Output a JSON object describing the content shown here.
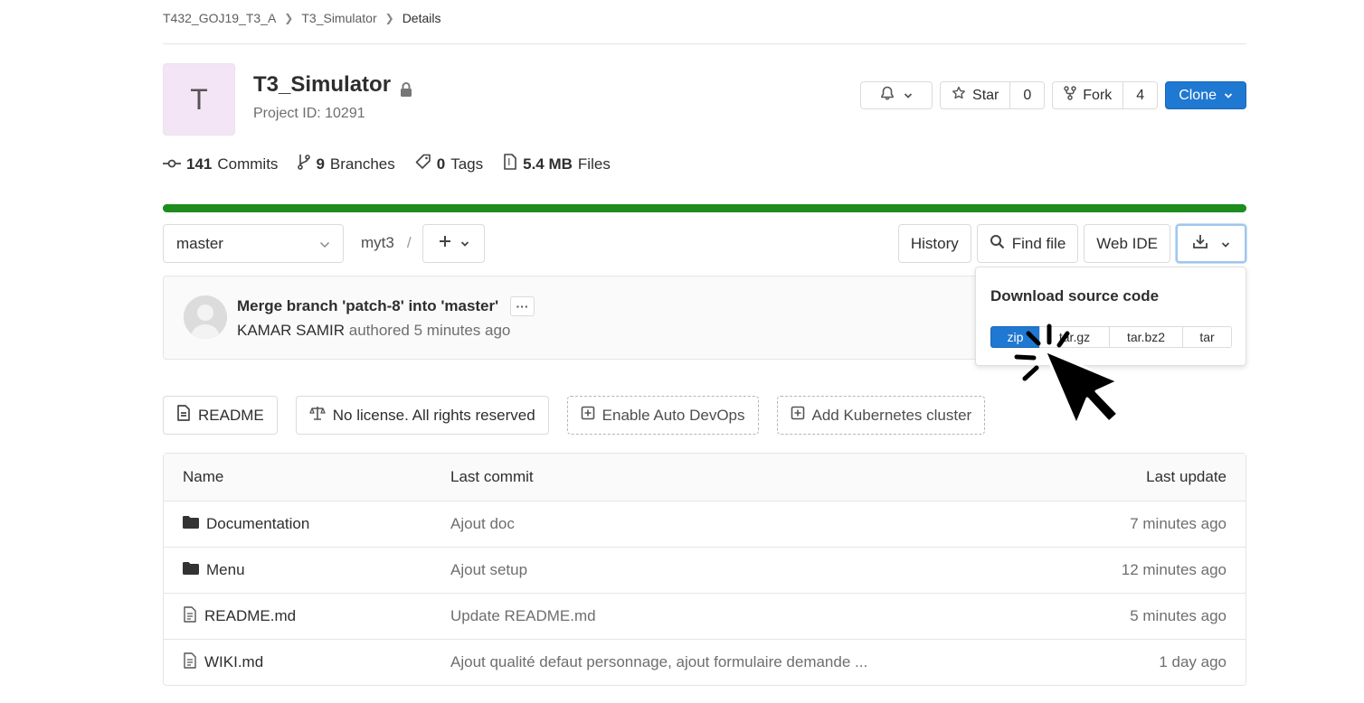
{
  "breadcrumb": [
    "T432_GOJ19_T3_A",
    "T3_Simulator",
    "Details"
  ],
  "project": {
    "avatar_letter": "T",
    "name": "T3_Simulator",
    "id_label": "Project ID: 10291"
  },
  "header_buttons": {
    "star_label": "Star",
    "star_count": "0",
    "fork_label": "Fork",
    "fork_count": "4",
    "clone_label": "Clone"
  },
  "stats": {
    "commits_count": "141",
    "commits_label": "Commits",
    "branches_count": "9",
    "branches_label": "Branches",
    "tags_count": "0",
    "tags_label": "Tags",
    "files_size": "5.4 MB",
    "files_label": "Files"
  },
  "language_bar": {
    "color": "#1f8c1f",
    "fraction": 1.0
  },
  "tree": {
    "branch": "master",
    "path": "myt3",
    "history_label": "History",
    "find_file_label": "Find file",
    "web_ide_label": "Web IDE"
  },
  "commit": {
    "message": "Merge branch 'patch-8' into 'master'",
    "author": "KAMAR SAMIR",
    "meta": "authored 5 minutes ago"
  },
  "download_dropdown": {
    "title": "Download source code",
    "formats": [
      "zip",
      "tar.gz",
      "tar.bz2",
      "tar"
    ]
  },
  "badges": {
    "readme": "README",
    "license": "No license. All rights reserved",
    "auto_devops": "Enable Auto DevOps",
    "kubernetes": "Add Kubernetes cluster"
  },
  "files_table": {
    "headers": {
      "name": "Name",
      "last_commit": "Last commit",
      "last_update": "Last update"
    },
    "rows": [
      {
        "name": "Documentation",
        "type": "folder",
        "commit": "Ajout doc",
        "updated": "7 minutes ago"
      },
      {
        "name": "Menu",
        "type": "folder",
        "commit": "Ajout setup",
        "updated": "12 minutes ago"
      },
      {
        "name": "README.md",
        "type": "file",
        "commit": "Update README.md",
        "updated": "5 minutes ago"
      },
      {
        "name": "WIKI.md",
        "type": "file",
        "commit": "Ajout qualité defaut personnage, ajout formulaire demande ...",
        "updated": "1 day ago"
      }
    ]
  },
  "colors": {
    "accent": "#1f78d1",
    "progress": "#1f8c1f",
    "avatar_bg": "#f3e5f5"
  },
  "icons": [
    "chevron-right-icon",
    "lock-icon",
    "bell-icon",
    "star-icon",
    "fork-icon",
    "commit-icon",
    "branch-icon",
    "tag-icon",
    "file-archive-icon",
    "search-icon",
    "download-icon",
    "plus-icon",
    "document-icon",
    "scale-icon",
    "plus-square-icon",
    "folder-icon",
    "file-icon",
    "pointer-cursor-icon"
  ]
}
